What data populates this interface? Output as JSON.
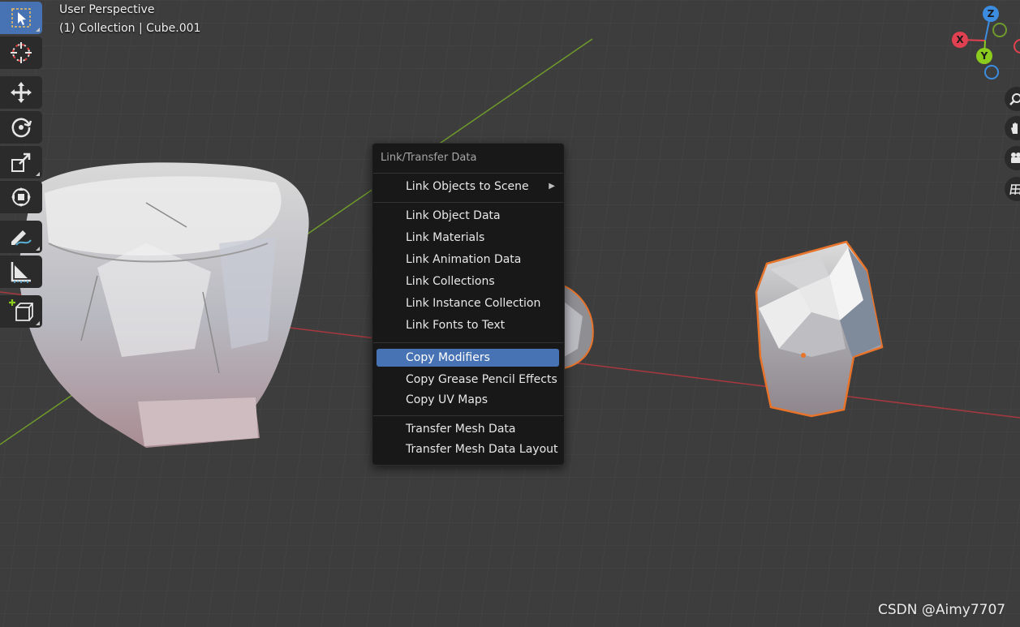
{
  "viewport": {
    "view_name": "User Perspective",
    "collection_info": "(1) Collection | Cube.001"
  },
  "toolbar": {
    "tools": [
      {
        "name": "select-box",
        "icon": "select-box-icon",
        "active": true
      },
      {
        "name": "cursor",
        "icon": "cursor-icon",
        "active": false
      },
      {
        "name": "move",
        "icon": "move-icon",
        "active": false
      },
      {
        "name": "rotate",
        "icon": "rotate-icon",
        "active": false
      },
      {
        "name": "scale",
        "icon": "scale-icon",
        "active": false
      },
      {
        "name": "transform",
        "icon": "transform-icon",
        "active": false
      },
      {
        "name": "annotate",
        "icon": "annotate-icon",
        "active": false
      },
      {
        "name": "measure",
        "icon": "measure-icon",
        "active": false
      },
      {
        "name": "add-cube",
        "icon": "add-cube-icon",
        "active": false
      }
    ]
  },
  "gizmo": {
    "x_label": "X",
    "y_label": "Y",
    "z_label": "Z",
    "colors": {
      "x": "#e0404f",
      "y": "#8bcb1e",
      "z": "#3c8de0"
    }
  },
  "nav_buttons": [
    "zoom-icon",
    "hand-icon",
    "camera-icon",
    "grid-icon"
  ],
  "menu": {
    "title": "Link/Transfer Data",
    "items": [
      {
        "label": "Link Objects to Scene",
        "submenu": true,
        "highlighted": false
      },
      {
        "label": "Link Object Data",
        "highlighted": false
      },
      {
        "label": "Link Materials",
        "highlighted": false
      },
      {
        "label": "Link Animation Data",
        "highlighted": false
      },
      {
        "label": "Link Collections",
        "highlighted": false
      },
      {
        "label": "Link Instance Collection",
        "highlighted": false
      },
      {
        "label": "Link Fonts to Text",
        "highlighted": false
      },
      {
        "label": "Copy Modifiers",
        "highlighted": true
      },
      {
        "label": "Copy Grease Pencil Effects",
        "highlighted": false
      },
      {
        "label": "Copy UV Maps",
        "highlighted": false
      },
      {
        "label": "Transfer Mesh Data",
        "highlighted": false
      },
      {
        "label": "Transfer Mesh Data Layout",
        "highlighted": false
      }
    ],
    "submenu_arrow": "▶"
  },
  "colors": {
    "accent": "#4772b3",
    "selection_outline": "#e8732a",
    "x_axis_line": "#a8383f",
    "y_axis_line": "#6f9a2b"
  },
  "watermark": "CSDN @Aimy7707"
}
